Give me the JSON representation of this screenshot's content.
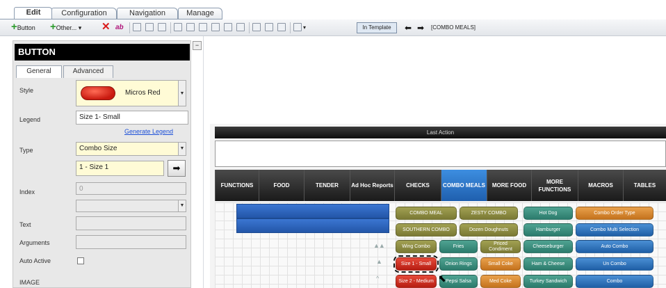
{
  "tabs": [
    "Edit",
    "Configuration",
    "Navigation",
    "Manage"
  ],
  "toolbar": {
    "button_label": "Button",
    "other_label": "Other...",
    "ab_label": "ab",
    "in_template": "In Template",
    "breadcrumb": "[COMBO MEALS]"
  },
  "panel": {
    "title": "BUTTON",
    "tabs": [
      "General",
      "Advanced"
    ],
    "labels": {
      "style": "Style",
      "legend": "Legend",
      "type": "Type",
      "index": "Index",
      "text": "Text",
      "arguments": "Arguments",
      "auto_active": "Auto Active",
      "image": "IMAGE"
    },
    "style_value": "Micros Red",
    "legend_value": "Size 1- Small",
    "generate_legend": "Generate Legend",
    "type_value": "Combo Size",
    "size_value": "1 - Size 1",
    "index_value": "0"
  },
  "canvas": {
    "last_action": "Last Action",
    "categories": [
      {
        "label": "FUNCTIONS"
      },
      {
        "label": "FOOD"
      },
      {
        "label": "TENDER"
      },
      {
        "label": "Ad Hoc Reports"
      },
      {
        "label": "CHECKS"
      },
      {
        "label": "COMBO MEALS"
      },
      {
        "label": "MORE FOOD"
      },
      {
        "label": "MORE FUNCTIONS"
      },
      {
        "label": "MACROS"
      },
      {
        "label": "TABLES"
      }
    ],
    "buttons": {
      "combo_meal": "COMBO MEAL",
      "zesty_combo": "ZESTY COMBO",
      "hot_dog": "Hot Dog",
      "combo_order_type": "Combo Order Type",
      "southern_combo": "SOUTHERN COMBO",
      "dozen_doughnuts": "Dozen Doughnuts",
      "hamburger": "Hamburger",
      "combo_multi_selection": "Combo Multi Selection",
      "wing_combo": "Wing Combo",
      "fries": "Fries",
      "priced_condiment": "Priced Condiment",
      "cheeseburger": "Cheeseburger",
      "auto_combo": "Auto Combo",
      "size1_small": "Size 1 - Small",
      "onion_rings": "Onion Rings",
      "small_coke": "Small Coke",
      "ham_cheese": "Ham & Cheese",
      "un_combo": "Un Combo",
      "size2_medium": "Size 2 - Medium",
      "pepsi_salsa": "Pepsi Salsa",
      "med_coke": "Med Coke",
      "turkey_sandwich": "Turkey Sandwich",
      "combo": "Combo"
    }
  },
  "colors": {
    "style_red": "#d0291c",
    "category_active": "#2f7fd2",
    "olive": "#8f8e42",
    "teal": "#3c8f7f",
    "orange": "#d98a35",
    "blue": "#3278c4"
  }
}
